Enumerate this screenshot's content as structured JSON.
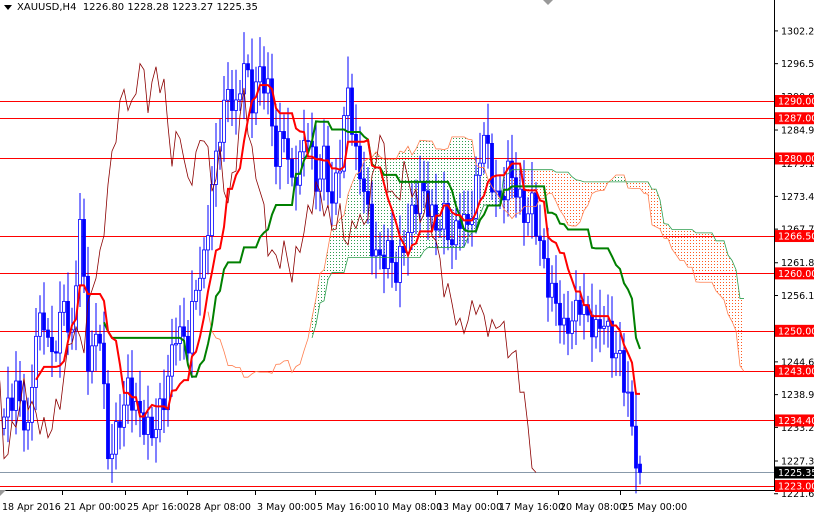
{
  "chart_data": {
    "type": "candlestick",
    "symbol": "XAUUSD,H4",
    "ohlc": {
      "open": "1226.80",
      "high": "1228.28",
      "low": "1223.27",
      "close": "1225.35"
    },
    "current_price": "1225.35",
    "ylim": [
      1221.65,
      1307
    ],
    "y_ticks": [
      "1302.20",
      "1296.50",
      "1290.80",
      "1284.95",
      "1279.10",
      "1273.40",
      "1267.70",
      "1261.85",
      "1256.15",
      "1250.45",
      "1244.60",
      "1238.90",
      "1233.20",
      "1227.35",
      "1221.65"
    ],
    "x_ticks": [
      "18 Apr 2016",
      "21 Apr 00:00",
      "25 Apr 16:00",
      "28 Apr 08:00",
      "3 May 00:00",
      "5 May 16:00",
      "10 May 08:00",
      "13 May 00:00",
      "17 May 16:00",
      "20 May 08:00",
      "25 May 00:00"
    ],
    "levels": [
      {
        "value": 1290,
        "label": "1290.00"
      },
      {
        "value": 1287,
        "label": "1287.00"
      },
      {
        "value": 1280,
        "label": "1280.00"
      },
      {
        "value": 1266.5,
        "label": "1266.50"
      },
      {
        "value": 1260,
        "label": "1260.00"
      },
      {
        "value": 1250,
        "label": "1250.00"
      },
      {
        "value": 1243,
        "label": "1243.00"
      },
      {
        "value": 1234.4,
        "label": "1234.40"
      },
      {
        "value": 1223,
        "label": "1223.00"
      }
    ],
    "close_path": [
      [
        0,
        1235
      ],
      [
        3,
        1240
      ],
      [
        6,
        1232
      ],
      [
        8,
        1250
      ],
      [
        10,
        1252
      ],
      [
        12,
        1245
      ],
      [
        15,
        1255
      ],
      [
        17,
        1248
      ],
      [
        19,
        1270
      ],
      [
        21,
        1245
      ],
      [
        24,
        1250
      ],
      [
        26,
        1228
      ],
      [
        28,
        1232
      ],
      [
        31,
        1240
      ],
      [
        34,
        1235
      ],
      [
        37,
        1232
      ],
      [
        40,
        1238
      ],
      [
        43,
        1250
      ],
      [
        46,
        1248
      ],
      [
        48,
        1258
      ],
      [
        50,
        1262
      ],
      [
        52,
        1275
      ],
      [
        54,
        1285
      ],
      [
        56,
        1292
      ],
      [
        58,
        1288
      ],
      [
        60,
        1297
      ],
      [
        62,
        1290
      ],
      [
        64,
        1295
      ],
      [
        66,
        1292
      ],
      [
        68,
        1280
      ],
      [
        70,
        1285
      ],
      [
        72,
        1275
      ],
      [
        74,
        1280
      ],
      [
        76,
        1285
      ],
      [
        78,
        1275
      ],
      [
        80,
        1280
      ],
      [
        82,
        1272
      ],
      [
        84,
        1280
      ],
      [
        86,
        1292
      ],
      [
        88,
        1280
      ],
      [
        90,
        1275
      ],
      [
        92,
        1265
      ],
      [
        94,
        1262
      ],
      [
        96,
        1264
      ],
      [
        98,
        1260
      ],
      [
        100,
        1265
      ],
      [
        102,
        1270
      ],
      [
        104,
        1275
      ],
      [
        106,
        1272
      ],
      [
        108,
        1268
      ],
      [
        110,
        1270
      ],
      [
        112,
        1265
      ],
      [
        114,
        1270
      ],
      [
        116,
        1268
      ],
      [
        118,
        1275
      ],
      [
        120,
        1285
      ],
      [
        122,
        1276
      ],
      [
        124,
        1272
      ],
      [
        126,
        1278
      ],
      [
        128,
        1275
      ],
      [
        130,
        1270
      ],
      [
        132,
        1272
      ],
      [
        134,
        1265
      ],
      [
        136,
        1258
      ],
      [
        138,
        1255
      ],
      [
        140,
        1250
      ],
      [
        142,
        1252
      ],
      [
        144,
        1255
      ],
      [
        146,
        1252
      ],
      [
        148,
        1250
      ],
      [
        150,
        1252
      ],
      [
        152,
        1247
      ],
      [
        154,
        1245
      ],
      [
        156,
        1238
      ],
      [
        158,
        1228
      ],
      [
        159,
        1225.35
      ]
    ],
    "indicator": "Ichimoku Kinko Hyo (9,26,52)",
    "colors": {
      "tenkan": "#ff0000",
      "kijun": "#008000",
      "chikou": "#8b0000",
      "cloud_up": "#2e9e4f",
      "cloud_down": "#ff5a1f",
      "candles": "#0000ff",
      "level": "#ff0000"
    }
  }
}
